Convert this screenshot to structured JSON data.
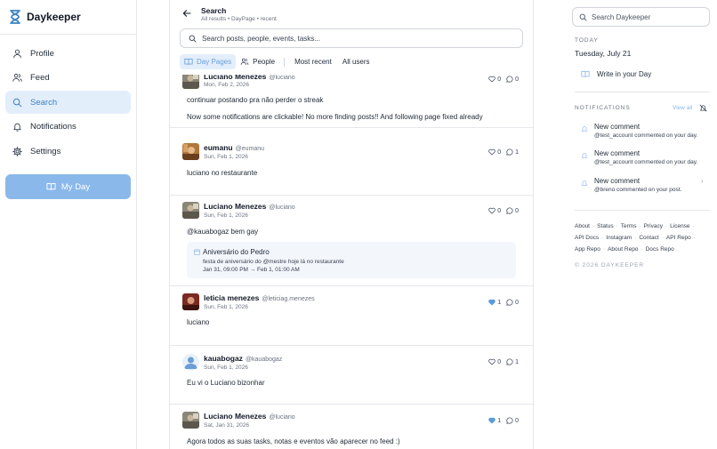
{
  "app": {
    "name": "Daykeeper"
  },
  "sidebar": {
    "items": [
      {
        "label": "Profile",
        "icon": "user-icon"
      },
      {
        "label": "Feed",
        "icon": "users-icon"
      },
      {
        "label": "Search",
        "icon": "search-icon"
      },
      {
        "label": "Notifications",
        "icon": "bell-icon"
      },
      {
        "label": "Settings",
        "icon": "gear-icon"
      }
    ],
    "active": "Search",
    "my_day_label": "My Day"
  },
  "header": {
    "title": "Search",
    "subtitle": "All results • DayPage • recent"
  },
  "search": {
    "placeholder": "Search posts, people, events, tasks..."
  },
  "tabs": [
    {
      "label": "Day Pages",
      "active": true
    },
    {
      "label": "People"
    },
    {
      "label": "Most recent"
    },
    {
      "label": "All users"
    }
  ],
  "posts": [
    {
      "name": "Luciano Menezes",
      "handle": "@luciano",
      "date": "Mon, Feb 2, 2026",
      "likes": "0",
      "comments": "0",
      "liked": false,
      "lines": [
        "continuar postando pra não perder o streak",
        "Now some notifications are clickable! No more finding posts!! And following page fixed already"
      ]
    },
    {
      "name": "eumanu",
      "handle": "@eumanu",
      "date": "Sun, Feb 1, 2026",
      "likes": "0",
      "comments": "1",
      "liked": false,
      "lines": [
        "luciano no restaurante"
      ]
    },
    {
      "name": "Luciano Menezes",
      "handle": "@luciano",
      "date": "Sun, Feb 1, 2026",
      "likes": "0",
      "comments": "0",
      "liked": false,
      "lines": [
        "@kauabogaz bem gay"
      ],
      "event": {
        "title": "Aniversário do Pedro",
        "description": "festa de aniversário do @mestre hoje lá no restaurante",
        "time": "Jan 31, 09:00 PM → Feb 1, 01:00 AM"
      }
    },
    {
      "name": "leticia menezes",
      "handle": "@leticiag.menezes",
      "date": "Sun, Feb 1, 2026",
      "likes": "1",
      "comments": "0",
      "liked": true,
      "lines": [
        "luciano"
      ]
    },
    {
      "name": "kauabogaz",
      "handle": "@kauabogaz",
      "date": "Sun, Feb 1, 2026",
      "likes": "0",
      "comments": "1",
      "liked": false,
      "lines": [
        "Eu vi o Luciano bizonhar"
      ]
    },
    {
      "name": "Luciano Menezes",
      "handle": "@luciano",
      "date": "Sat, Jan 31, 2026",
      "likes": "1",
      "comments": "0",
      "liked": true,
      "lines": [
        "Agora todos as suas tasks, notas e eventos vão aparecer no feed :)"
      ]
    }
  ],
  "rail": {
    "search_placeholder": "Search Daykeeper",
    "today_label": "TODAY",
    "today_date": "Tuesday, July 21",
    "write_label": "Write in your Day",
    "notifications_label": "NOTIFICATIONS",
    "view_all": "View all",
    "notifications": [
      {
        "title": "New comment",
        "body": "@test_account commented on your day."
      },
      {
        "title": "New comment",
        "body": "@test_account commented on your day."
      },
      {
        "title": "New comment",
        "body": "@breno commented on your post."
      }
    ],
    "footer_lines": [
      [
        "About",
        "Status",
        "Terms",
        "Privacy",
        "License"
      ],
      [
        "API Docs",
        "Instagram",
        "Contact",
        "API Repo"
      ],
      [
        "App Repo",
        "About Repo",
        "Docs Repo"
      ]
    ],
    "copyright": "© 2026 DAYKEEPER"
  },
  "colors": {
    "accent": "#8bb8ea",
    "active_bg": "#e3eefb",
    "brand": "#3b82c4",
    "liked": "#5b9bd8"
  }
}
